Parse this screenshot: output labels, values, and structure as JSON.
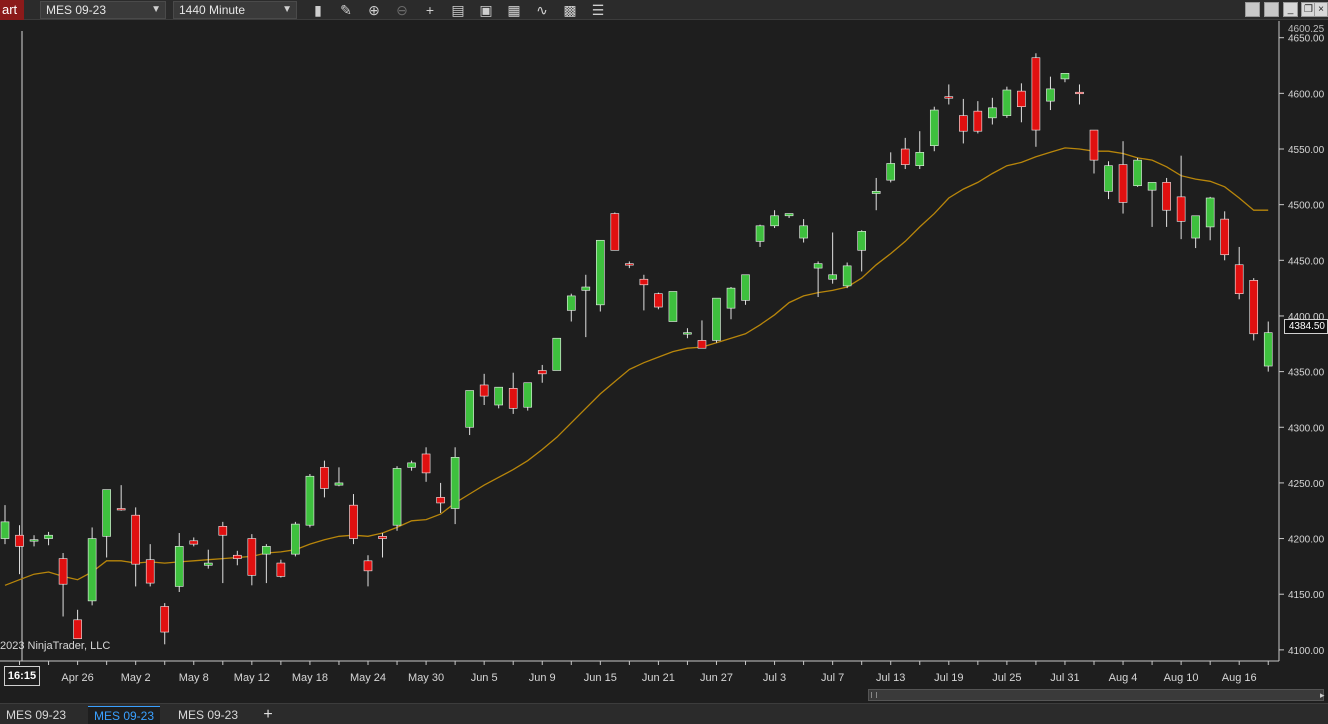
{
  "toolbar": {
    "app_label": "art",
    "instrument": "MES 09-23",
    "interval": "1440 Minute",
    "icons": [
      "bar-type-icon",
      "draw-pencil-icon",
      "zoom-in-icon",
      "zoom-out-icon",
      "crosshair-icon",
      "data-box-icon",
      "templates-icon",
      "indicators-icon",
      "strategies-icon",
      "properties-icon",
      "list-icon"
    ],
    "window_buttons": [
      "minimize",
      "restore",
      "close"
    ]
  },
  "chart": {
    "copyright": "2023 NinjaTrader, LLC",
    "time_label": "16:15",
    "current_price_label": "4384.50",
    "top_partial_label": "4600.25"
  },
  "chart_data": {
    "type": "candlestick",
    "instrument": "MES 09-23",
    "interval": "1440 Minute",
    "ylim": [
      4090,
      4665
    ],
    "y_ticks": [
      "4650.00",
      "4600.00",
      "4550.00",
      "4500.00",
      "4450.00",
      "4400.00",
      "4350.00",
      "4300.00",
      "4250.00",
      "4200.00",
      "4150.00",
      "4100.00"
    ],
    "x_ticks": [
      {
        "label": "Apr 26",
        "index": 5
      },
      {
        "label": "May 2",
        "index": 9
      },
      {
        "label": "May 8",
        "index": 13
      },
      {
        "label": "May 12",
        "index": 17
      },
      {
        "label": "May 18",
        "index": 21
      },
      {
        "label": "May 24",
        "index": 25
      },
      {
        "label": "May 30",
        "index": 29
      },
      {
        "label": "Jun 5",
        "index": 33
      },
      {
        "label": "Jun 9",
        "index": 37
      },
      {
        "label": "Jun 15",
        "index": 41
      },
      {
        "label": "Jun 21",
        "index": 45
      },
      {
        "label": "Jun 27",
        "index": 49
      },
      {
        "label": "Jul 3",
        "index": 53
      },
      {
        "label": "Jul 7",
        "index": 57
      },
      {
        "label": "Jul 13",
        "index": 61
      },
      {
        "label": "Jul 19",
        "index": 65
      },
      {
        "label": "Jul 25",
        "index": 69
      },
      {
        "label": "Jul 31",
        "index": 73
      },
      {
        "label": "Aug 4",
        "index": 77
      },
      {
        "label": "Aug 10",
        "index": 81
      },
      {
        "label": "Aug 16",
        "index": 85
      }
    ],
    "candles": [
      [
        4200,
        4230,
        4195,
        4215
      ],
      [
        4203,
        4212,
        4168,
        4193
      ],
      [
        4198,
        4203,
        4193,
        4199
      ],
      [
        4200,
        4206,
        4194,
        4203
      ],
      [
        4182,
        4187,
        4130,
        4159
      ],
      [
        4127,
        4136,
        4110,
        4110
      ],
      [
        4144,
        4210,
        4140,
        4200
      ],
      [
        4202,
        4230,
        4183,
        4244
      ],
      [
        4227,
        4248,
        4225,
        4226
      ],
      [
        4221,
        4228,
        4157,
        4177
      ],
      [
        4181,
        4195,
        4157,
        4160
      ],
      [
        4139,
        4142,
        4105,
        4116
      ],
      [
        4157,
        4205,
        4152,
        4193
      ],
      [
        4198,
        4201,
        4193,
        4195
      ],
      [
        4176,
        4190,
        4173,
        4178
      ],
      [
        4211,
        4215,
        4160,
        4203
      ],
      [
        4185,
        4189,
        4176,
        4182
      ],
      [
        4200,
        4204,
        4158,
        4167
      ],
      [
        4186,
        4195,
        4160,
        4193
      ],
      [
        4178,
        4181,
        4165,
        4166
      ],
      [
        4186,
        4215,
        4184,
        4213
      ],
      [
        4212,
        4258,
        4210,
        4256
      ],
      [
        4264,
        4270,
        4237,
        4245
      ],
      [
        4248,
        4264,
        4247,
        4250
      ],
      [
        4230,
        4240,
        4195,
        4200
      ],
      [
        4180,
        4185,
        4157,
        4171
      ],
      [
        4202,
        4205,
        4183,
        4200
      ],
      [
        4212,
        4265,
        4207,
        4263
      ],
      [
        4264,
        4270,
        4261,
        4268
      ],
      [
        4276,
        4282,
        4251,
        4259
      ],
      [
        4237,
        4250,
        4223,
        4232
      ],
      [
        4227,
        4282,
        4213,
        4273
      ],
      [
        4300,
        4330,
        4293,
        4333
      ],
      [
        4338,
        4348,
        4320,
        4328
      ],
      [
        4320,
        4336,
        4317,
        4336
      ],
      [
        4335,
        4349,
        4312,
        4317
      ],
      [
        4318,
        4339,
        4315,
        4340
      ],
      [
        4351,
        4356,
        4340,
        4348
      ],
      [
        4351,
        4380,
        4351,
        4380
      ],
      [
        4405,
        4420,
        4395,
        4418
      ],
      [
        4423,
        4437,
        4381,
        4426
      ],
      [
        4410,
        4465,
        4404,
        4468
      ],
      [
        4492,
        4493,
        4462,
        4459
      ],
      [
        4447,
        4449,
        4443,
        4446
      ],
      [
        4433,
        4437,
        4405,
        4428
      ],
      [
        4420,
        4421,
        4406,
        4408
      ],
      [
        4395,
        4421,
        4395,
        4422
      ],
      [
        4385,
        4389,
        4380,
        4385
      ],
      [
        4378,
        4396,
        4373,
        4371
      ],
      [
        4378,
        4412,
        4376,
        4416
      ],
      [
        4407,
        4426,
        4397,
        4425
      ],
      [
        4414,
        4436,
        4410,
        4437
      ],
      [
        4467,
        4482,
        4462,
        4481
      ],
      [
        4481,
        4495,
        4479,
        4490
      ],
      [
        4490,
        4492,
        4488,
        4492
      ],
      [
        4470,
        4487,
        4466,
        4481
      ],
      [
        4443,
        4449,
        4417,
        4447
      ],
      [
        4433,
        4475,
        4429,
        4437
      ],
      [
        4427,
        4448,
        4425,
        4445
      ],
      [
        4459,
        4477,
        4440,
        4476
      ],
      [
        4510,
        4524,
        4495,
        4512
      ],
      [
        4522,
        4547,
        4520,
        4537
      ],
      [
        4550,
        4560,
        4532,
        4536
      ],
      [
        4535,
        4566,
        4532,
        4547
      ],
      [
        4553,
        4588,
        4548,
        4585
      ],
      [
        4597,
        4608,
        4590,
        4596
      ],
      [
        4580,
        4595,
        4555,
        4566
      ],
      [
        4584,
        4593,
        4564,
        4566
      ],
      [
        4578,
        4596,
        4572,
        4587
      ],
      [
        4580,
        4606,
        4578,
        4603
      ],
      [
        4602,
        4609,
        4574,
        4588
      ],
      [
        4632,
        4636,
        4552,
        4567
      ],
      [
        4593,
        4615,
        4585,
        4604
      ],
      [
        4613,
        4617,
        4610,
        4618
      ],
      [
        4601,
        4608,
        4590,
        4600
      ],
      [
        4567,
        4567,
        4528,
        4540
      ],
      [
        4512,
        4539,
        4505,
        4535
      ],
      [
        4536,
        4557,
        4492,
        4502
      ],
      [
        4517,
        4542,
        4516,
        4540
      ],
      [
        4513,
        4520,
        4480,
        4520
      ],
      [
        4520,
        4524,
        4480,
        4495
      ],
      [
        4507,
        4544,
        4469,
        4485
      ],
      [
        4470,
        4486,
        4461,
        4490
      ],
      [
        4480,
        4507,
        4468,
        4506
      ],
      [
        4487,
        4494,
        4450,
        4455
      ],
      [
        4446,
        4462,
        4415,
        4420
      ],
      [
        4432,
        4434,
        4378,
        4384
      ],
      [
        4355,
        4395,
        4350,
        4385
      ]
    ],
    "series": [
      {
        "name": "SMA",
        "color": "#b8860b",
        "values": [
          4158,
          4163,
          4168,
          4170,
          4166,
          4163,
          4170,
          4180,
          4180,
          4178,
          4179,
          4178,
          4179,
          4180,
          4181,
          4182,
          4183,
          4184,
          4187,
          4188,
          4190,
          4195,
          4199,
          4202,
          4203,
          4202,
          4205,
          4210,
          4216,
          4217,
          4222,
          4232,
          4240,
          4248,
          4255,
          4262,
          4270,
          4280,
          4291,
          4304,
          4317,
          4330,
          4341,
          4352,
          4358,
          4363,
          4368,
          4371,
          4372,
          4376,
          4380,
          4384,
          4392,
          4401,
          4412,
          4418,
          4421,
          4423,
          4426,
          4434,
          4446,
          4456,
          4467,
          4480,
          4492,
          4506,
          4514,
          4520,
          4528,
          4535,
          4538,
          4543,
          4547,
          4551,
          4550,
          4548,
          4548,
          4546,
          4542,
          4540,
          4534,
          4526,
          4523,
          4521,
          4516,
          4506,
          4495,
          4495
        ]
      }
    ],
    "colors": {
      "up": "#3ec03e",
      "down": "#e01010",
      "background": "#1e1e1e",
      "axis": "#d0d0d0"
    },
    "grid": false
  },
  "tabs": [
    {
      "label": "MES 09-23",
      "active": false
    },
    {
      "label": "MES 09-23",
      "active": true
    },
    {
      "label": "MES 09-23",
      "active": false
    }
  ],
  "tab_add_label": "+"
}
